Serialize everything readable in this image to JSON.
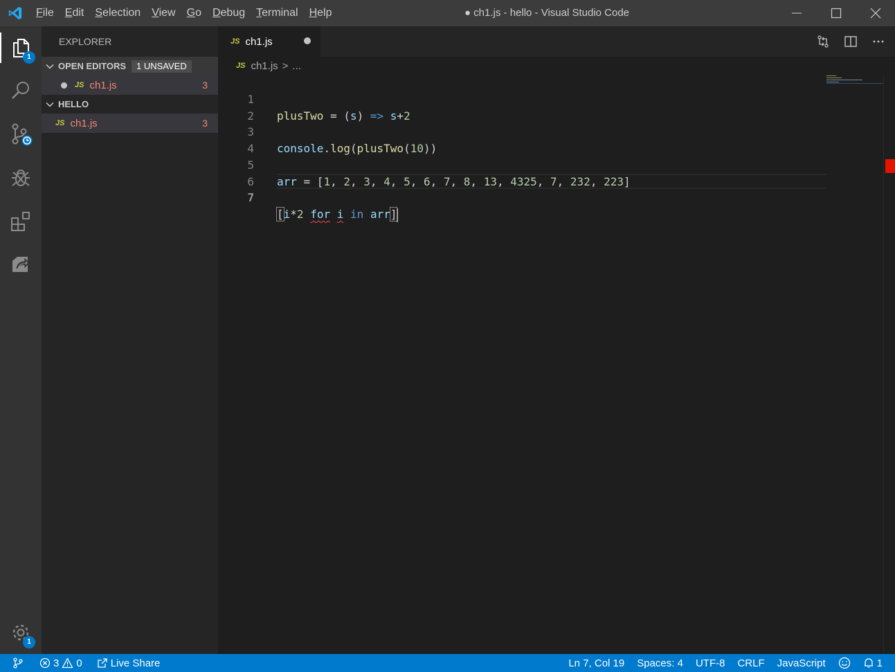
{
  "window": {
    "title": "● ch1.js - hello - Visual Studio Code"
  },
  "menu": [
    {
      "first": "F",
      "rest": "ile"
    },
    {
      "first": "E",
      "rest": "dit"
    },
    {
      "first": "S",
      "rest": "election"
    },
    {
      "first": "V",
      "rest": "iew"
    },
    {
      "first": "G",
      "rest": "o"
    },
    {
      "first": "D",
      "rest": "ebug"
    },
    {
      "first": "T",
      "rest": "erminal"
    },
    {
      "first": "H",
      "rest": "elp"
    }
  ],
  "activity": {
    "explorer_badge": "1",
    "settings_badge": "1"
  },
  "sidebar": {
    "title": "EXPLORER",
    "open_editors": {
      "label": "OPEN EDITORS",
      "badge": "1 UNSAVED",
      "file_icon": "JS",
      "file": "ch1.js",
      "problems": "3"
    },
    "folder": {
      "label": "HELLO",
      "file_icon": "JS",
      "file": "ch1.js",
      "problems": "3"
    }
  },
  "tab": {
    "icon": "JS",
    "label": "ch1.js"
  },
  "breadcrumb": {
    "icon": "JS",
    "file": "ch1.js",
    "separator": ">",
    "rest": "..."
  },
  "editor": {
    "line_numbers": [
      "1",
      "2",
      "3",
      "4",
      "5",
      "6",
      "7"
    ],
    "current_line": 7
  },
  "statusbar": {
    "errors": "3",
    "warnings": "0",
    "live_share": "Live Share",
    "position": "Ln 7, Col 19",
    "spaces": "Spaces: 4",
    "encoding": "UTF-8",
    "eol": "CRLF",
    "language": "JavaScript",
    "notifications": "1"
  },
  "colors": {
    "accent": "#007acc",
    "error": "#f48771"
  }
}
